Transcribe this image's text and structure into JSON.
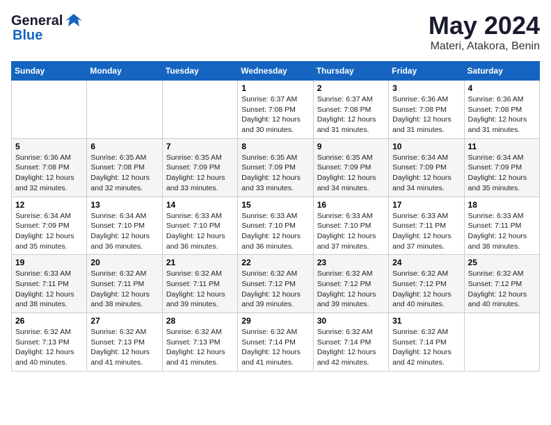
{
  "logo": {
    "general": "General",
    "blue": "Blue"
  },
  "title": {
    "month_year": "May 2024",
    "location": "Materi, Atakora, Benin"
  },
  "days_of_week": [
    "Sunday",
    "Monday",
    "Tuesday",
    "Wednesday",
    "Thursday",
    "Friday",
    "Saturday"
  ],
  "weeks": [
    [
      {
        "day": "",
        "info": ""
      },
      {
        "day": "",
        "info": ""
      },
      {
        "day": "",
        "info": ""
      },
      {
        "day": "1",
        "info": "Sunrise: 6:37 AM\nSunset: 7:08 PM\nDaylight: 12 hours\nand 30 minutes."
      },
      {
        "day": "2",
        "info": "Sunrise: 6:37 AM\nSunset: 7:08 PM\nDaylight: 12 hours\nand 31 minutes."
      },
      {
        "day": "3",
        "info": "Sunrise: 6:36 AM\nSunset: 7:08 PM\nDaylight: 12 hours\nand 31 minutes."
      },
      {
        "day": "4",
        "info": "Sunrise: 6:36 AM\nSunset: 7:08 PM\nDaylight: 12 hours\nand 31 minutes."
      }
    ],
    [
      {
        "day": "5",
        "info": "Sunrise: 6:36 AM\nSunset: 7:08 PM\nDaylight: 12 hours\nand 32 minutes."
      },
      {
        "day": "6",
        "info": "Sunrise: 6:35 AM\nSunset: 7:08 PM\nDaylight: 12 hours\nand 32 minutes."
      },
      {
        "day": "7",
        "info": "Sunrise: 6:35 AM\nSunset: 7:09 PM\nDaylight: 12 hours\nand 33 minutes."
      },
      {
        "day": "8",
        "info": "Sunrise: 6:35 AM\nSunset: 7:09 PM\nDaylight: 12 hours\nand 33 minutes."
      },
      {
        "day": "9",
        "info": "Sunrise: 6:35 AM\nSunset: 7:09 PM\nDaylight: 12 hours\nand 34 minutes."
      },
      {
        "day": "10",
        "info": "Sunrise: 6:34 AM\nSunset: 7:09 PM\nDaylight: 12 hours\nand 34 minutes."
      },
      {
        "day": "11",
        "info": "Sunrise: 6:34 AM\nSunset: 7:09 PM\nDaylight: 12 hours\nand 35 minutes."
      }
    ],
    [
      {
        "day": "12",
        "info": "Sunrise: 6:34 AM\nSunset: 7:09 PM\nDaylight: 12 hours\nand 35 minutes."
      },
      {
        "day": "13",
        "info": "Sunrise: 6:34 AM\nSunset: 7:10 PM\nDaylight: 12 hours\nand 36 minutes."
      },
      {
        "day": "14",
        "info": "Sunrise: 6:33 AM\nSunset: 7:10 PM\nDaylight: 12 hours\nand 36 minutes."
      },
      {
        "day": "15",
        "info": "Sunrise: 6:33 AM\nSunset: 7:10 PM\nDaylight: 12 hours\nand 36 minutes."
      },
      {
        "day": "16",
        "info": "Sunrise: 6:33 AM\nSunset: 7:10 PM\nDaylight: 12 hours\nand 37 minutes."
      },
      {
        "day": "17",
        "info": "Sunrise: 6:33 AM\nSunset: 7:11 PM\nDaylight: 12 hours\nand 37 minutes."
      },
      {
        "day": "18",
        "info": "Sunrise: 6:33 AM\nSunset: 7:11 PM\nDaylight: 12 hours\nand 38 minutes."
      }
    ],
    [
      {
        "day": "19",
        "info": "Sunrise: 6:33 AM\nSunset: 7:11 PM\nDaylight: 12 hours\nand 38 minutes."
      },
      {
        "day": "20",
        "info": "Sunrise: 6:32 AM\nSunset: 7:11 PM\nDaylight: 12 hours\nand 38 minutes."
      },
      {
        "day": "21",
        "info": "Sunrise: 6:32 AM\nSunset: 7:11 PM\nDaylight: 12 hours\nand 39 minutes."
      },
      {
        "day": "22",
        "info": "Sunrise: 6:32 AM\nSunset: 7:12 PM\nDaylight: 12 hours\nand 39 minutes."
      },
      {
        "day": "23",
        "info": "Sunrise: 6:32 AM\nSunset: 7:12 PM\nDaylight: 12 hours\nand 39 minutes."
      },
      {
        "day": "24",
        "info": "Sunrise: 6:32 AM\nSunset: 7:12 PM\nDaylight: 12 hours\nand 40 minutes."
      },
      {
        "day": "25",
        "info": "Sunrise: 6:32 AM\nSunset: 7:12 PM\nDaylight: 12 hours\nand 40 minutes."
      }
    ],
    [
      {
        "day": "26",
        "info": "Sunrise: 6:32 AM\nSunset: 7:13 PM\nDaylight: 12 hours\nand 40 minutes."
      },
      {
        "day": "27",
        "info": "Sunrise: 6:32 AM\nSunset: 7:13 PM\nDaylight: 12 hours\nand 41 minutes."
      },
      {
        "day": "28",
        "info": "Sunrise: 6:32 AM\nSunset: 7:13 PM\nDaylight: 12 hours\nand 41 minutes."
      },
      {
        "day": "29",
        "info": "Sunrise: 6:32 AM\nSunset: 7:14 PM\nDaylight: 12 hours\nand 41 minutes."
      },
      {
        "day": "30",
        "info": "Sunrise: 6:32 AM\nSunset: 7:14 PM\nDaylight: 12 hours\nand 42 minutes."
      },
      {
        "day": "31",
        "info": "Sunrise: 6:32 AM\nSunset: 7:14 PM\nDaylight: 12 hours\nand 42 minutes."
      },
      {
        "day": "",
        "info": ""
      }
    ]
  ]
}
